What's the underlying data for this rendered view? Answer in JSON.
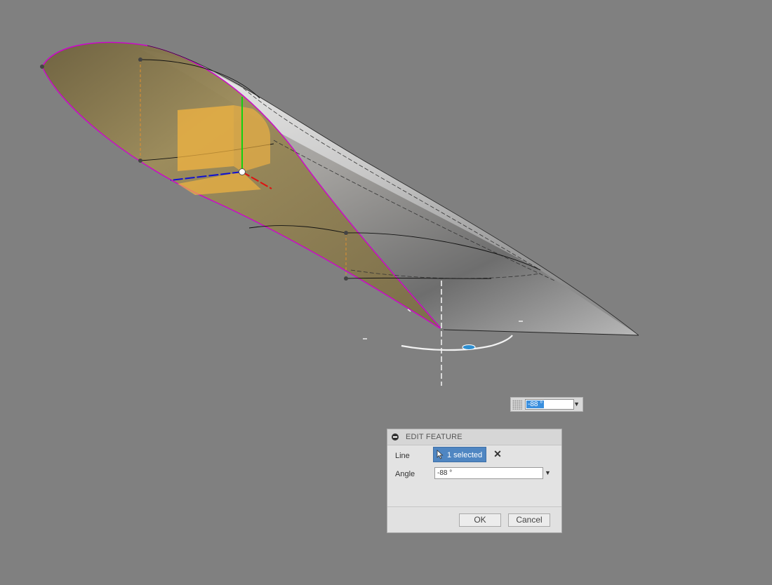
{
  "viewport": {
    "description_colors": {
      "background": "#808080",
      "profile_edge": "#d000d0",
      "section_fill": "#8a7a4a",
      "box_fill": "#f5b540",
      "axis_x": "#e01010",
      "axis_y": "#10d010",
      "axis_z": "#1010d0"
    }
  },
  "floating_input": {
    "value": "-88 °",
    "icon": "dropdown-arrow-icon"
  },
  "dialog": {
    "title": "EDIT FEATURE",
    "line_label": "Line",
    "line_selection": "1 selected",
    "angle_label": "Angle",
    "angle_value": "-88 °",
    "ok_label": "OK",
    "cancel_label": "Cancel"
  }
}
